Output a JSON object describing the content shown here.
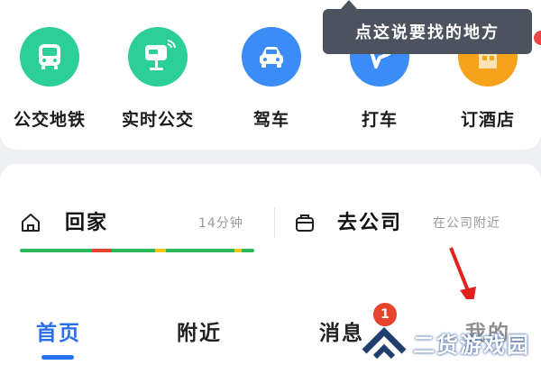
{
  "services": [
    {
      "label": "公交地铁",
      "icon": "bus-icon",
      "color": "#2ccf97"
    },
    {
      "label": "实时公交",
      "icon": "bus-stop-sign-icon",
      "color": "#2ccf97"
    },
    {
      "label": "驾车",
      "icon": "car-icon",
      "color": "#3b8cf6"
    },
    {
      "label": "打车",
      "icon": "taxi-icon",
      "color": "#3b8cf6"
    },
    {
      "label": "订酒店",
      "icon": "hotel-icon",
      "color": "#f7a21b"
    }
  ],
  "tooltip": {
    "text": "点这说要找的地方"
  },
  "commute": {
    "home": {
      "title": "回家",
      "eta": "14分钟",
      "icon": "home-icon"
    },
    "work": {
      "title": "去公司",
      "note": "在公司附近",
      "icon": "briefcase-icon"
    }
  },
  "tabs": [
    {
      "label": "首页",
      "active": true
    },
    {
      "label": "附近",
      "active": false
    },
    {
      "label": "消息",
      "active": false,
      "badge": "1"
    },
    {
      "label": "我的",
      "active": false
    }
  ],
  "watermark": {
    "text": "二货游戏园"
  },
  "colors": {
    "accent": "#2a6ef0",
    "green": "#2ccf97",
    "blue": "#3b8cf6",
    "orange": "#f7a21b",
    "badge": "#e8432e"
  }
}
